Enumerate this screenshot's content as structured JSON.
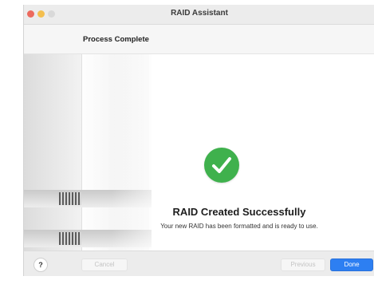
{
  "window": {
    "title": "RAID Assistant"
  },
  "header": {
    "step_title": "Process Complete"
  },
  "content": {
    "success_title": "RAID Created Successfully",
    "success_message": "Your new RAID has been formatted and is ready to use."
  },
  "footer": {
    "help_label": "?",
    "cancel_label": "Cancel",
    "previous_label": "Previous",
    "done_label": "Done"
  },
  "icons": {
    "success": "checkmark-circle-icon"
  },
  "colors": {
    "success_green": "#3fb14d",
    "primary_blue": "#2d7ff2"
  }
}
